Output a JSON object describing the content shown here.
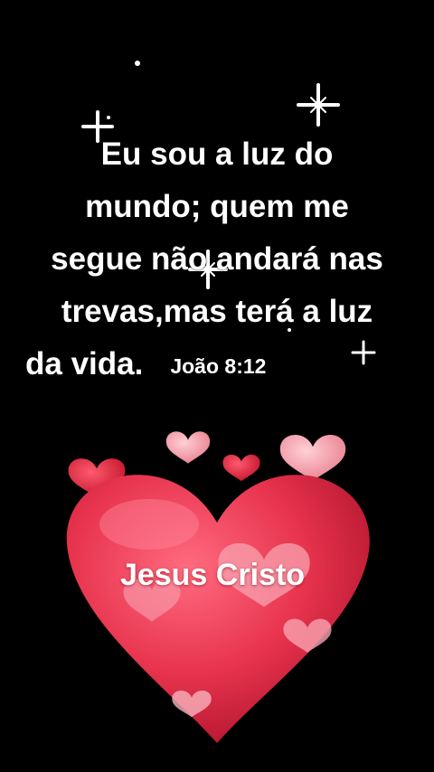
{
  "verse": {
    "lines": [
      "Eu sou a luz do",
      "mundo; quem me",
      "segue não andará nas",
      "trevas,mas terá a luz",
      "da vida."
    ],
    "reference": "João 8:12"
  },
  "heart_label": "Jesus Cristo",
  "colors": {
    "background": "#000000",
    "text": "#ffffff",
    "heart_main": "#e8344f",
    "heart_light": "#f7a3ae",
    "heart_dark": "#c01e36"
  }
}
